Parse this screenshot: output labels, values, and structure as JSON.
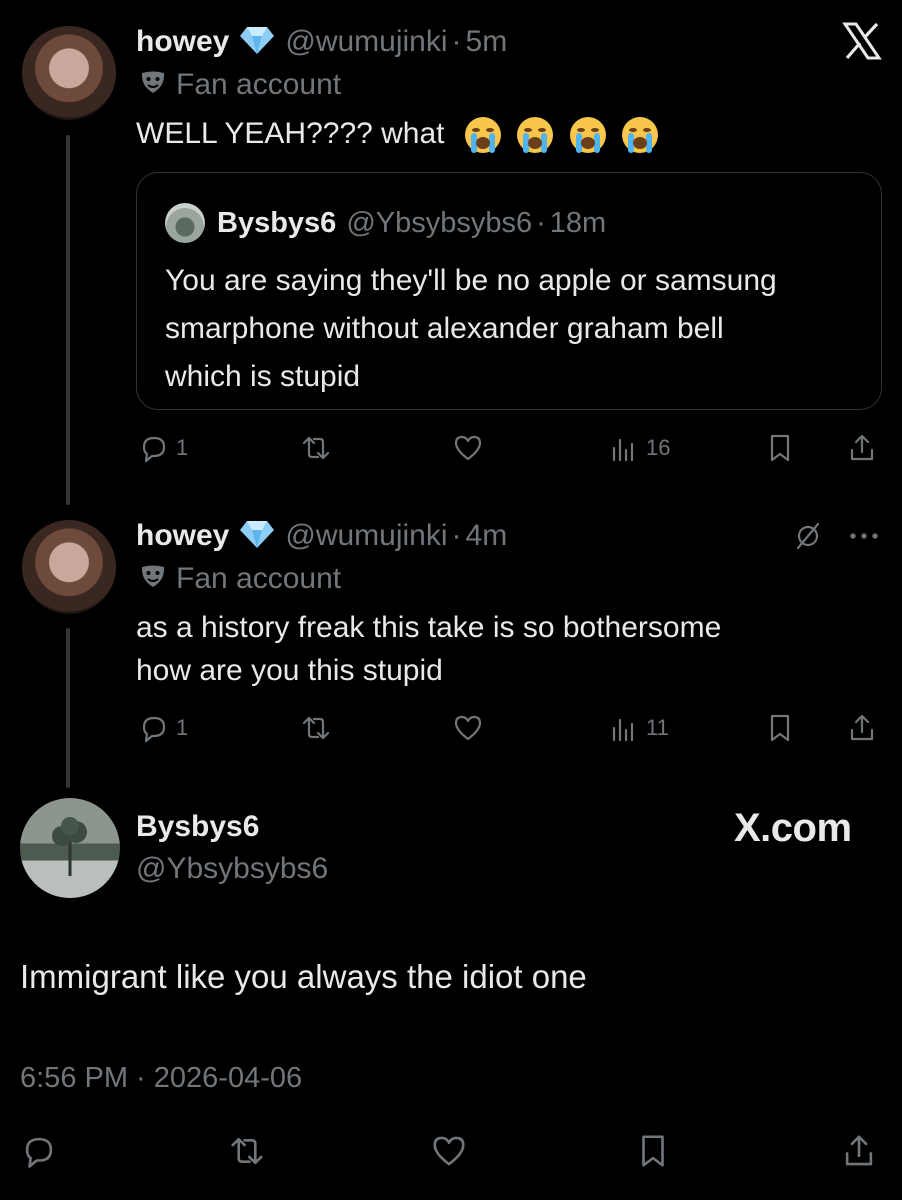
{
  "tweet1": {
    "name": "howey",
    "handle": "@wumujinki",
    "time": "5m",
    "label": "Fan account",
    "text": "WELL YEAH???? what",
    "emoji_count": 4,
    "quote": {
      "name": "Bysbys6",
      "handle": "@Ybsybsybs6",
      "time": "18m",
      "text_lines": [
        "You are saying they'll be no apple or samsung",
        "smarphone without alexander graham bell",
        "which is stupid"
      ]
    },
    "replies": "1",
    "views": "16"
  },
  "tweet2": {
    "name": "howey",
    "handle": "@wumujinki",
    "time": "4m",
    "label": "Fan account",
    "text_lines": [
      "as a history freak this take is so bothersome",
      "how are you this stupid"
    ],
    "replies": "1",
    "views": "11"
  },
  "main": {
    "name": "Bysbys6",
    "handle": "@Ybsybsybs6",
    "brand": "X.com",
    "text": "Immigrant like you always the idiot one",
    "timestamp": "6:56 PM · 2026-04-06"
  },
  "colors": {
    "bg": "#000000",
    "text": "#e7e9ea",
    "muted": "#71767b",
    "border": "#2f3336",
    "verified": "#8ecdf5"
  },
  "icons": [
    "x-logo-icon",
    "verified-diamond-icon",
    "fan-mask-icon",
    "reply-icon",
    "retweet-icon",
    "like-icon",
    "views-icon",
    "bookmark-icon",
    "share-icon",
    "mute-slash-icon",
    "more-icon"
  ]
}
